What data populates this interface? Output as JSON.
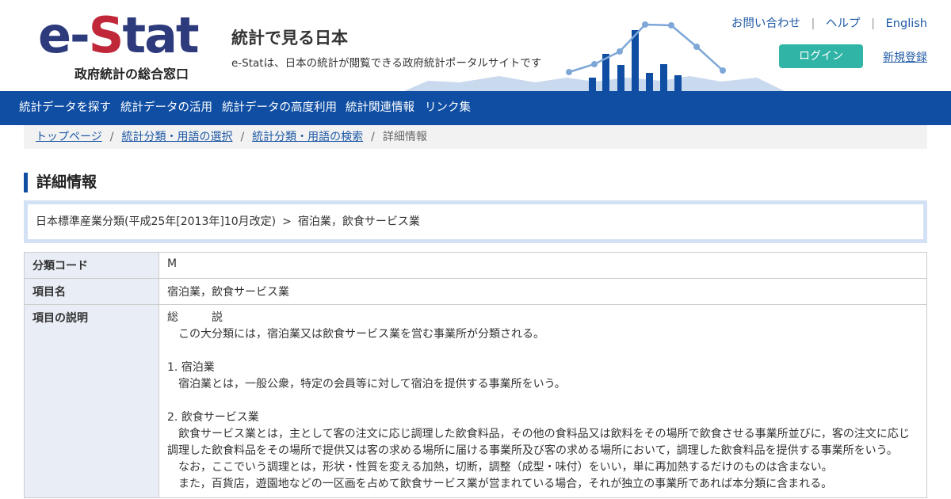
{
  "header": {
    "logo_text_prefix": "e-",
    "logo_text_s": "S",
    "logo_text_suffix": "tat",
    "logo_subtitle": "政府統計の総合窓口",
    "site_title": "統計で見る日本",
    "site_description": "e-Statは、日本の統計が閲覧できる政府統計ポータルサイトです",
    "util_links": {
      "contact": "お問い合わせ",
      "help": "ヘルプ",
      "english": "English",
      "separator": "|"
    },
    "login_label": "ログイン",
    "register_label": "新規登録"
  },
  "nav": {
    "items": [
      {
        "label": "統計データを探す"
      },
      {
        "label": "統計データの活用"
      },
      {
        "label": "統計データの高度利用"
      },
      {
        "label": "統計関連情報"
      },
      {
        "label": "リンク集"
      }
    ]
  },
  "breadcrumb": {
    "items": [
      "トップページ",
      "統計分類・用語の選択",
      "統計分類・用語の検索"
    ],
    "current": "詳細情報",
    "separator": "/"
  },
  "page": {
    "heading": "詳細情報",
    "path": {
      "classification": "日本標準産業分類(平成25年[2013年]10月改定)",
      "arrow": ">",
      "category": "宿泊業，飲食サービス業"
    }
  },
  "detail": {
    "code_label": "分類コード",
    "code_value": "M",
    "name_label": "項目名",
    "name_value": "宿泊業，飲食サービス業",
    "description_label": "項目の説明",
    "description_lines": [
      "総　　　説",
      "　この大分類には，宿泊業又は飲食サービス業を営む事業所が分類される。",
      "",
      "1. 宿泊業",
      "　宿泊業とは，一般公衆，特定の会員等に対して宿泊を提供する事業所をいう。",
      "",
      "2. 飲食サービス業",
      "　飲食サービス業とは，主として客の注文に応じ調理した飲食料品，その他の食料品又は飲料をその場所で飲食させる事業所並びに，客の注文に応じ調理した飲食料品をその場所で提供又は客の求める場所に届ける事業所及び客の求める場所において，調理した飲食料品を提供する事業所をいう。",
      "　なお，ここでいう調理とは，形状・性質を変える加熱，切断，調整（成型・味付）をいい，単に再加熱するだけのものは含まない。",
      "　また，百貨店，遊園地などの一区画を占めて飲食サービス業が営まれている場合，それが独立の事業所であれば本分類に含まれる。"
    ]
  },
  "colors": {
    "brand_blue": "#0f4ea3",
    "logo_navy": "#2d3a7c",
    "logo_red": "#c0283a",
    "login_teal": "#2fb4a6",
    "link_blue": "#1f5aa6",
    "table_header_bg": "#e9eef6",
    "path_box_border": "#d3e1f4"
  }
}
